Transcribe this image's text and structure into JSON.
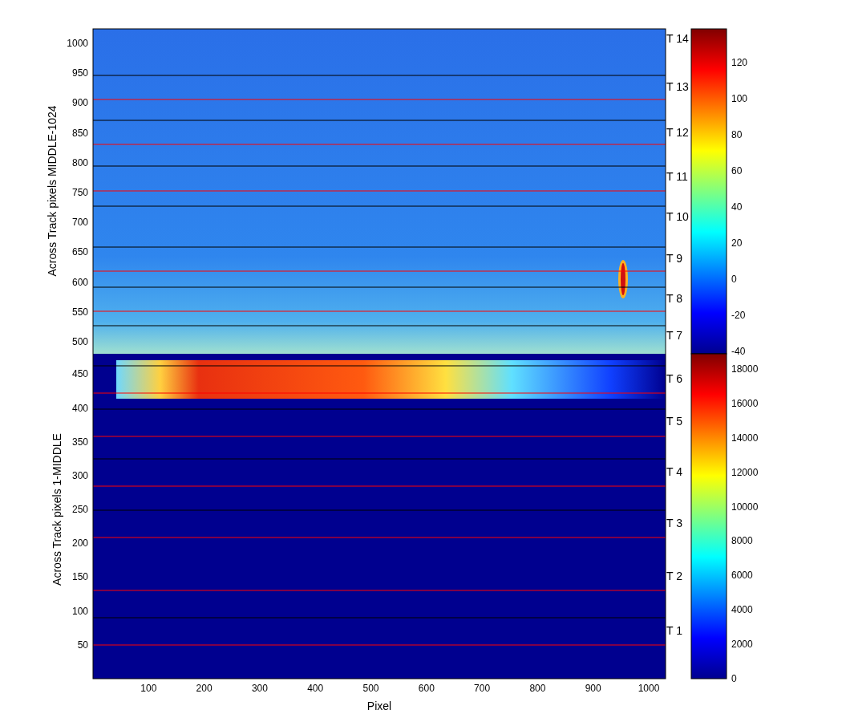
{
  "plot": {
    "xlabel": "Pixel",
    "xticks": [
      "100",
      "200",
      "300",
      "400",
      "500",
      "600",
      "700",
      "800",
      "900",
      "1000"
    ],
    "upper_panel": {
      "ylabel": "Across Track pixels MIDDLE-1024",
      "yticks": [
        "1000",
        "950",
        "900",
        "850",
        "800",
        "750",
        "700",
        "650",
        "600",
        "550",
        "500"
      ]
    },
    "lower_panel": {
      "ylabel": "Across Track pixels 1-MIDDLE",
      "yticks": [
        "450",
        "400",
        "350",
        "300",
        "250",
        "200",
        "150",
        "100",
        "50"
      ]
    },
    "track_labels": [
      "T 14",
      "T 13",
      "T 12",
      "T 11",
      "T 10",
      "T 9",
      "T 8",
      "T 7",
      "T 6",
      "T 5",
      "T 4",
      "T 3",
      "T 2",
      "T 1"
    ]
  },
  "colorbars": [
    {
      "ticks": [
        "120",
        "100",
        "80",
        "60",
        "40",
        "20",
        "0",
        "-20",
        "-40"
      ]
    },
    {
      "ticks": [
        "18000",
        "16000",
        "14000",
        "12000",
        "10000",
        "8000",
        "6000",
        "4000",
        "2000",
        "0"
      ]
    }
  ]
}
